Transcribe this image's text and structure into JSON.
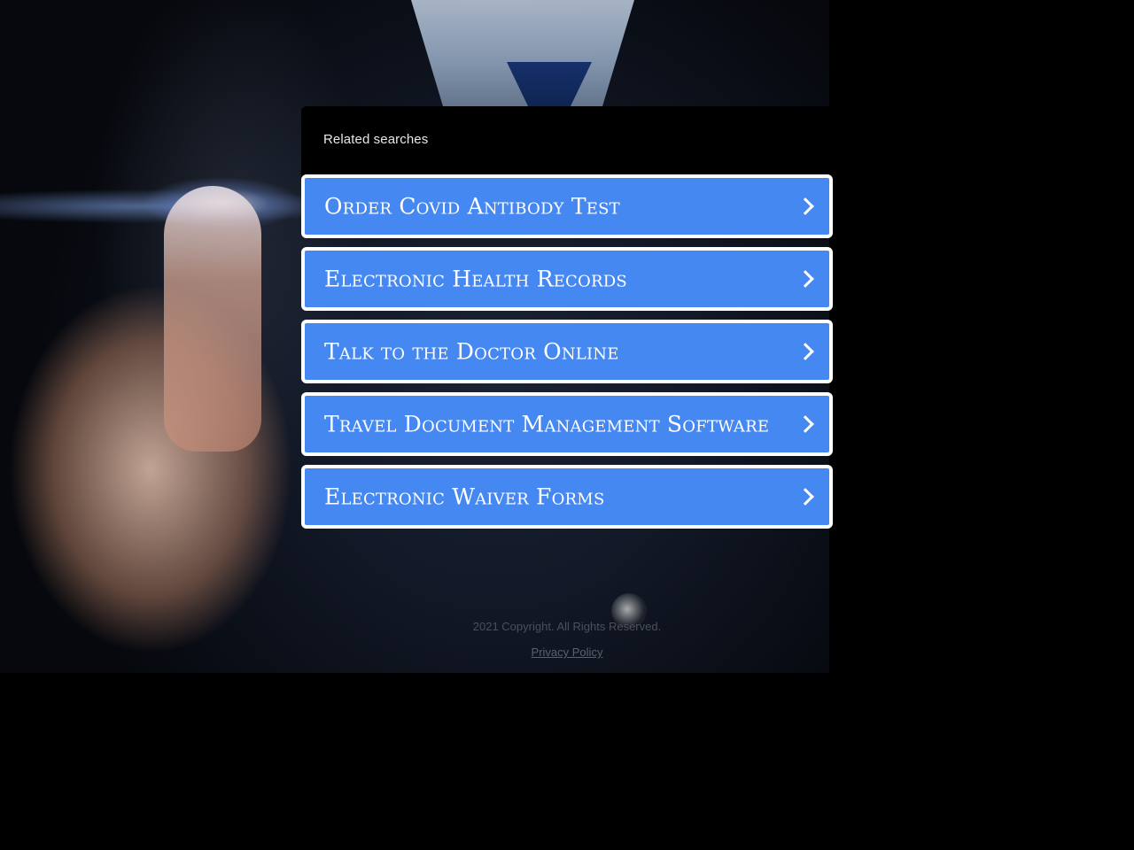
{
  "related": {
    "label": "Related searches",
    "items": [
      {
        "label": "Order Covid Antibody Test"
      },
      {
        "label": "Electronic Health Records"
      },
      {
        "label": "Talk to the Doctor Online"
      },
      {
        "label": "Travel Document Management Software"
      },
      {
        "label": "Electronic Waiver Forms"
      }
    ],
    "button_color": "#4688f1",
    "button_border_color": "#ffffff",
    "chevron_icon": "chevron-right-icon"
  },
  "footer": {
    "copyright": "2021 Copyright. All Rights Reserved.",
    "privacy_label": "Privacy Policy"
  }
}
